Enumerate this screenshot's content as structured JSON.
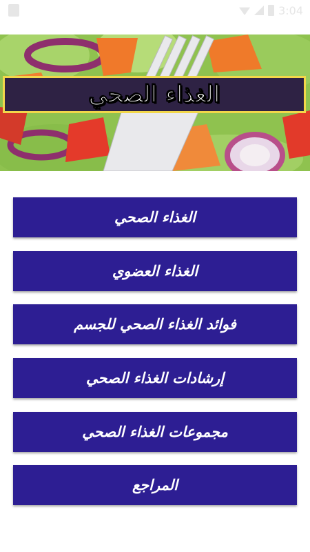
{
  "status_bar": {
    "time": "3:04",
    "icons": [
      "notification-icon",
      "wifi-icon",
      "signal-icon",
      "battery-icon"
    ]
  },
  "header": {
    "title": "الغذاء الصحي"
  },
  "menu": {
    "items": [
      {
        "label": "الغذاء الصحي"
      },
      {
        "label": "الغذاء العضوي"
      },
      {
        "label": "فوائد الغذاء الصحي للجسم"
      },
      {
        "label": "إرشادات الغذاء الصحي"
      },
      {
        "label": "مجموعات الغذاء الصحي"
      },
      {
        "label": "المراجع"
      }
    ]
  },
  "colors": {
    "button_bg": "#2d1e93",
    "banner_bg": "#2e2244",
    "banner_border": "#f2d74a"
  }
}
